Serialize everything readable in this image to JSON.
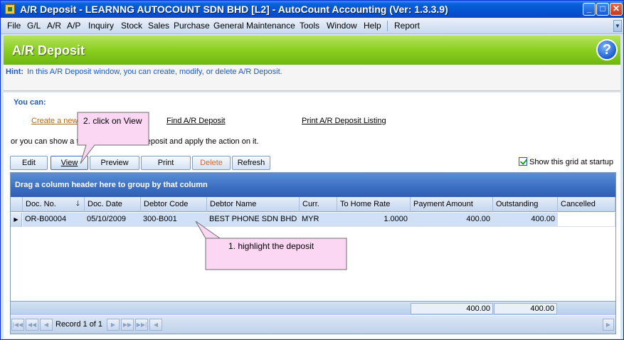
{
  "window": {
    "title": "A/R Deposit - LEARNNG AUTOCOUNT SDN BHD [L2] - AutoCount Accounting (Ver: 1.3.3.9)"
  },
  "menu": [
    "File",
    "G/L",
    "A/R",
    "A/P",
    "Inquiry",
    "Stock",
    "Sales",
    "Purchase",
    "General Maintenance",
    "Tools",
    "Window",
    "Help",
    "Report"
  ],
  "header": {
    "title": "A/R Deposit"
  },
  "hint": {
    "label": "Hint:",
    "text": "In this A/R Deposit window, you can create, modify, or delete A/R Deposit."
  },
  "actions": {
    "you_can": "You can:",
    "create_link": "Create a new",
    "find_link": "Find A/R Deposit",
    "listing_link": "Print A/R Deposit Listing",
    "or_text": "or you can show a                                  then find your A/R Deposit and apply the action on it."
  },
  "toolbar": {
    "edit": "Edit",
    "view": "View",
    "preview": "Preview",
    "print": "Print",
    "delete": "Delete",
    "refresh": "Refresh"
  },
  "startup": {
    "label": "Show this grid at startup",
    "checked": true
  },
  "grid": {
    "group_hint": "Drag a column header here to group by that column",
    "columns": [
      "Doc. No.",
      "Doc. Date",
      "Debtor Code",
      "Debtor Name",
      "Curr.",
      "To Home Rate",
      "Payment Amount",
      "Outstanding",
      "Cancelled"
    ],
    "rows": [
      {
        "doc_no": "OR-B00004",
        "doc_date": "05/10/2009",
        "debtor_code": "300-B001",
        "debtor_name": "BEST PHONE SDN BHD",
        "curr": "MYR",
        "rate": "1.0000",
        "payment": "400.00",
        "outstanding": "400.00",
        "cancelled": ""
      }
    ],
    "totals": {
      "payment": "400.00",
      "outstanding": "400.00"
    },
    "record_text": "Record 1 of 1"
  },
  "callouts": {
    "view": "2. click on View",
    "highlight": "1. highlight the deposit"
  }
}
